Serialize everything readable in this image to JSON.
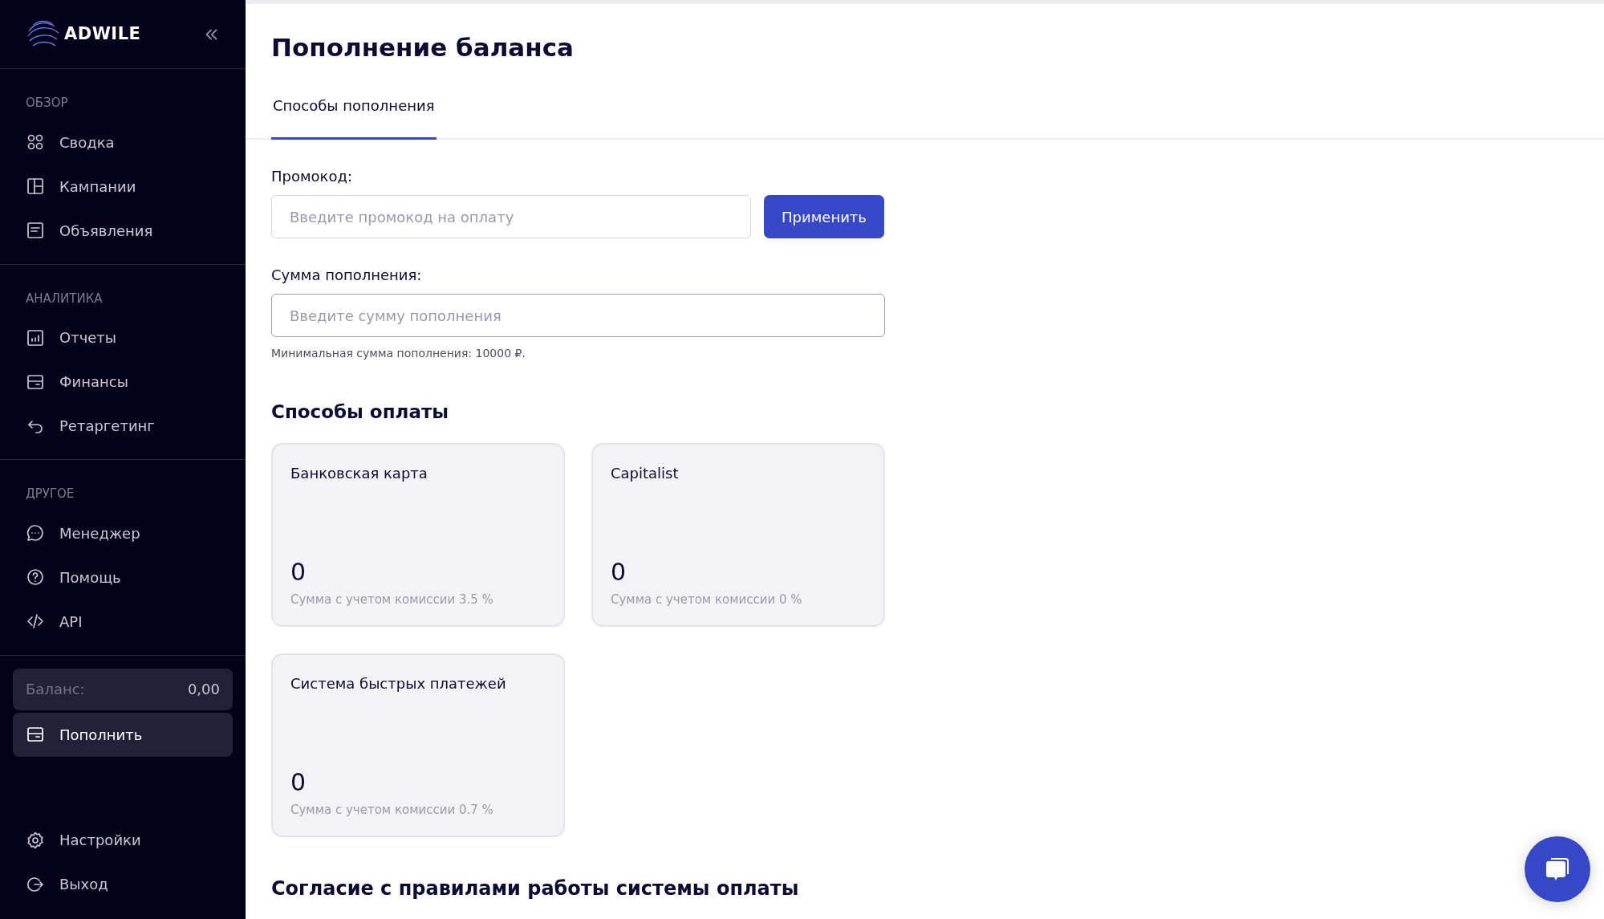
{
  "sidebar": {
    "logo": "ADWILE",
    "sections": [
      {
        "title": "ОБЗОР",
        "items": [
          {
            "label": "Сводка",
            "selected": false
          },
          {
            "label": "Кампании",
            "selected": false
          },
          {
            "label": "Объявления",
            "selected": false
          }
        ]
      },
      {
        "title": "АНАЛИТИКА",
        "items": [
          {
            "label": "Отчеты",
            "selected": false
          },
          {
            "label": "Финансы",
            "selected": false
          },
          {
            "label": "Ретаргетинг",
            "selected": false
          }
        ]
      },
      {
        "title": "ДРУГОЕ",
        "items": [
          {
            "label": "Менеджер",
            "selected": false
          },
          {
            "label": "Помощь",
            "selected": false
          },
          {
            "label": "API",
            "selected": false
          }
        ]
      }
    ],
    "balance": {
      "label": "Баланс:",
      "value": "0,00"
    },
    "topup": {
      "label": "Пополнить",
      "selected": true
    },
    "bottom_items": [
      {
        "label": "Настройки",
        "selected": false
      },
      {
        "label": "Выход",
        "selected": false
      }
    ]
  },
  "main": {
    "title": "Пополнение баланса",
    "tabs": [
      {
        "label": "Способы пополнения",
        "selected": true
      }
    ],
    "promo": {
      "label": "Промокод:",
      "placeholder": "Введите промокод на оплату",
      "button": "Применить"
    },
    "amount": {
      "label": "Сумма пополнения:",
      "placeholder": "Введите сумму пополнения",
      "hint": "Минимальная сумма пополнения: 10000 ₽."
    },
    "methods_title": "Способы оплаты",
    "methods": [
      {
        "name": "Банковская карта",
        "amount": "0",
        "note": "Сумма с учетом комиссии 3.5 %"
      },
      {
        "name": "Capitalist",
        "amount": "0",
        "note": "Сумма с учетом комиссии 0 %"
      },
      {
        "name": "Система быстрых платежей",
        "amount": "0",
        "note": "Сумма с учетом комиссии 0.7 %"
      }
    ],
    "agreement_title": "Согласие с правилами работы системы оплаты"
  }
}
